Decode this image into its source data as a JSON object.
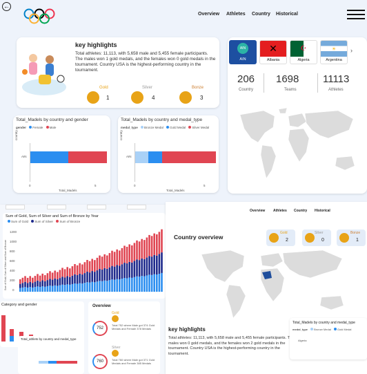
{
  "nav": {
    "links": [
      "Overview",
      "Athletes",
      "Country",
      "Historical"
    ]
  },
  "top_highlights": {
    "title": "key highlights",
    "text": "Total athletes: 11,113, with 5,658 male and 5,455 female participants. The males won 1 gold medals, and the females won 0 gold medals in the tournament. Country USA is the highest-performing country in the tournament.",
    "gold_label": "Gold",
    "gold_value": "1",
    "silver_label": "Silver",
    "silver_value": "4",
    "bronze_label": "Bonze",
    "bronze_value": "3"
  },
  "flags": [
    "AIN",
    "Albania",
    "Algeria",
    "Argentina"
  ],
  "flag_badge": "AIN",
  "stats": {
    "country_value": "206",
    "country_label": "Country",
    "teams_value": "1698",
    "teams_label": "Teams",
    "athletes_value": "11113",
    "athletes_label": "Athletes"
  },
  "chart_gender": {
    "title": "Total_Madels by country and gender",
    "legend_title": "gender",
    "legend": [
      "Female",
      "Male"
    ],
    "ylabel": "country",
    "xlabel": "Total_Madels",
    "ticks": [
      "0",
      "5"
    ],
    "category": "AIN"
  },
  "chart_medaltype": {
    "title": "Total_Madels by country and medal_type",
    "legend_title": "medal_type",
    "legend": [
      "Bronze Medal",
      "Gold Medal",
      "Silver Medal"
    ],
    "ylabel": "country",
    "xlabel": "Total_Madels",
    "ticks": [
      "0",
      "5"
    ],
    "category": "AIN"
  },
  "historical_chart": {
    "title": "Sum of Gold, Sum of Silver and Sum of Bronze by Year",
    "legend": [
      "Sum of Gold",
      "Sum of Silver",
      "Sum of Bronze"
    ],
    "ylabel": "Sum of Gold, Sum of Silver and Sum of Bronze",
    "yticks": [
      "0",
      "200",
      "400",
      "600",
      "800",
      "1000",
      "1200"
    ]
  },
  "overview2": {
    "title": "Overview",
    "gold_label": "Gold",
    "gold_value": "752",
    "gold_text": "Total 752 where Male got 374 Gold Medals and Female 378 Medals",
    "silver_label": "Silver",
    "silver_value": "760",
    "silver_text": "Total 760 where Male got 371 Gold Medals and Female 385 Medals"
  },
  "gender_panel_title": "Category and gender",
  "athletes_panel_title": "Total_athlets by country and medal_type",
  "country_overview": {
    "nav": [
      "Overview",
      "Athletes",
      "Country",
      "Historical"
    ],
    "title": "Country overview",
    "gold_label": "Gold",
    "gold_value": "2",
    "silver_label": "Silver",
    "silver_value": "0",
    "bronze_label": "Bonze",
    "bronze_value": "1",
    "highlights_title": "key highlights",
    "highlights_text": "Total athletes: 11,113, with 5,658 male and 5,455 female participants. The males won 0 gold medals, and the females won 2 gold medals in the tournament. Country USA is the highest-performing country in the tournament.",
    "mini_chart_title": "Total_Madels by country and medal_type",
    "mini_legend_title": "medal_type",
    "mini_legend": [
      "Bronze Medal",
      "Gold Medal"
    ],
    "mini_category": "Algeria"
  },
  "colors": {
    "gold": "#e8a317",
    "silver": "#c0c0c0",
    "bronze": "#cd7f32",
    "female": "#2b8ef0",
    "male": "#e04552",
    "navy": "#1e2a8c",
    "light_blue": "#a9d1f7"
  }
}
